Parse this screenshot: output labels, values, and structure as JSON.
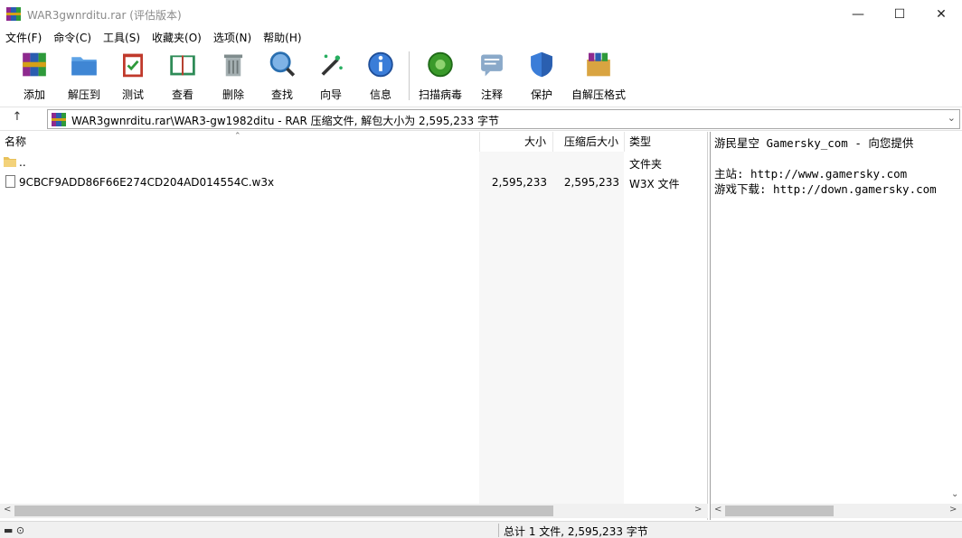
{
  "window": {
    "title": "WAR3gwnrditu.rar (评估版本)",
    "minimize": "—",
    "maximize": "☐",
    "close": "✕"
  },
  "menu": [
    "文件(F)",
    "命令(C)",
    "工具(S)",
    "收藏夹(O)",
    "选项(N)",
    "帮助(H)"
  ],
  "toolbar": [
    {
      "label": "添加",
      "icon": "add-archive-icon",
      "color": "#c0392b"
    },
    {
      "label": "解压到",
      "icon": "extract-folder-icon",
      "color": "#4a90d9"
    },
    {
      "label": "测试",
      "icon": "test-clipboard-icon",
      "color": "#c0392b"
    },
    {
      "label": "查看",
      "icon": "view-book-icon",
      "color": "#2e8b57"
    },
    {
      "label": "删除",
      "icon": "delete-trash-icon",
      "color": "#7f8c8d"
    },
    {
      "label": "查找",
      "icon": "find-magnifier-icon",
      "color": "#2a6fb0"
    },
    {
      "label": "向导",
      "icon": "wizard-wand-icon",
      "color": "#27ae60"
    },
    {
      "label": "信息",
      "icon": "info-icon",
      "color": "#2a6fb0"
    },
    {
      "label": "扫描病毒",
      "icon": "virus-scan-icon",
      "color": "#3a9a2a"
    },
    {
      "label": "注释",
      "icon": "comment-icon",
      "color": "#6a8db0"
    },
    {
      "label": "保护",
      "icon": "shield-icon",
      "color": "#3b7dd8"
    },
    {
      "label": "自解压格式",
      "icon": "sfx-box-icon",
      "color": "#d35400"
    }
  ],
  "address": {
    "up": "↑",
    "path": "WAR3gwnrditu.rar\\WAR3-gw1982ditu - RAR 压缩文件, 解包大小为 2,595,233 字节",
    "dropdown": "⌄"
  },
  "columns": {
    "name": "名称",
    "size": "大小",
    "packed": "压缩后大小",
    "type": "类型"
  },
  "files": [
    {
      "name": "..",
      "size": "",
      "packed": "",
      "type": "文件夹",
      "kind": "folder"
    },
    {
      "name": "9CBCF9ADD86F66E274CD204AD014554C.w3x",
      "size": "2,595,233",
      "packed": "2,595,233",
      "type": "W3X 文件",
      "kind": "file"
    }
  ],
  "comment": [
    "游民星空 Gamersky_com - 向您提供",
    "",
    "主站: http://www.gamersky.com",
    "游戏下载: http://down.gamersky.com"
  ],
  "status": {
    "icons": "▬ ⊙",
    "text": "总计 1 文件, 2,595,233 字节"
  }
}
